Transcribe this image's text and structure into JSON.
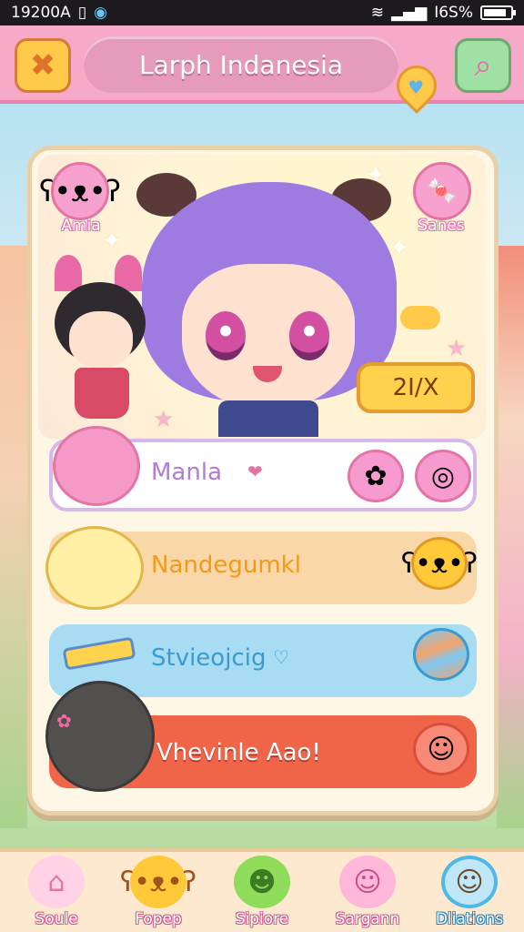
{
  "status_bar": {
    "time": "19200A",
    "battery": "I6S%",
    "battery_level": 0.85
  },
  "header": {
    "title": "Larph Indanesia",
    "left_icon": "crossed-tools-icon",
    "right_icon": "search-icon",
    "pin_icon": "heart-pin-icon"
  },
  "hero": {
    "corner_left_label": "Amia",
    "corner_right_label": "Sanes",
    "badge": "2I/X"
  },
  "rows": [
    {
      "label": "Manla",
      "suffix": "❤",
      "color": "#b27bd6"
    },
    {
      "label": "Nandegumkl",
      "color": "#f39a1a"
    },
    {
      "label": "Stvieojcig",
      "suffix": "♡",
      "color": "#3a9bd0"
    },
    {
      "label": "Vhevinle Aao!",
      "color": "#ffffff"
    }
  ],
  "bottom_nav": [
    {
      "label": "Soule",
      "icon": "home-icon"
    },
    {
      "label": "Fopep",
      "icon": "bear-icon"
    },
    {
      "label": "Sipiore",
      "icon": "frog-icon"
    },
    {
      "label": "Sargann",
      "icon": "bunny-icon"
    },
    {
      "label": "Dliations",
      "icon": "girl-avatar-icon",
      "active": true
    }
  ],
  "colors": {
    "header_bg": "#f7a9c8",
    "panel_bg": "#fff7e6",
    "accent_yellow": "#ffd14d",
    "row_red": "#f06447"
  }
}
